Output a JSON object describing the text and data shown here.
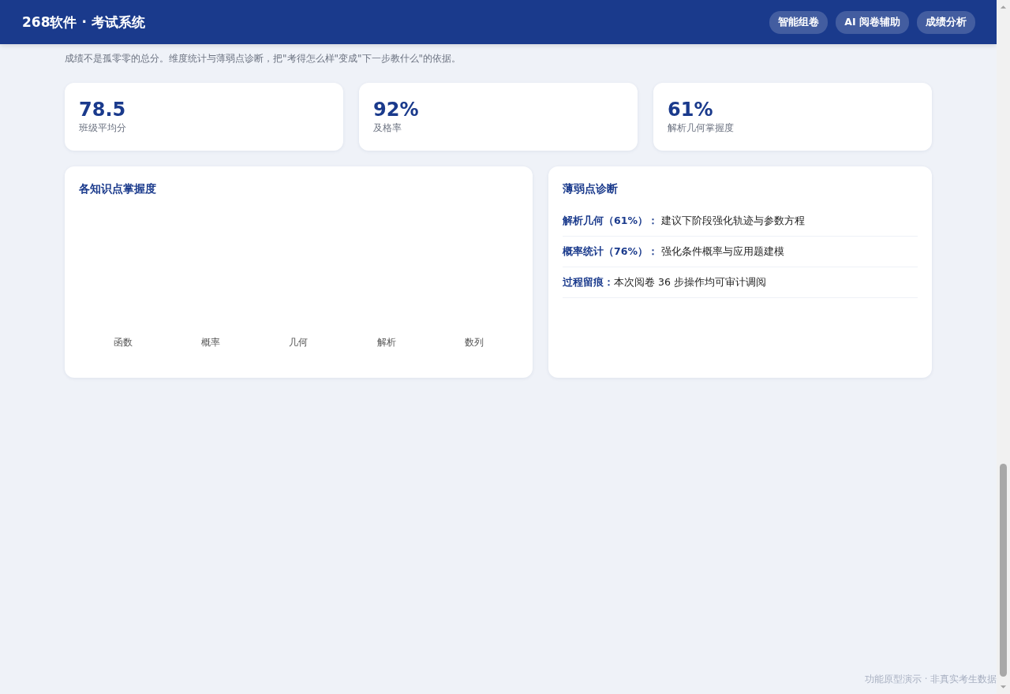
{
  "header": {
    "brand": "268软件 · 考试系统",
    "nav": [
      {
        "label": "智能组卷"
      },
      {
        "label": "AI 阅卷辅助"
      },
      {
        "label": "成绩分析"
      }
    ]
  },
  "subtitle": "成绩不是孤零零的总分。维度统计与薄弱点诊断，把\"考得怎么样\"变成\"下一步教什么\"的依据。",
  "stats": [
    {
      "value": "78.5",
      "label": "班级平均分"
    },
    {
      "value": "92%",
      "label": "及格率"
    },
    {
      "value": "61%",
      "label": "解析几何掌握度"
    }
  ],
  "mastery_panel": {
    "title": "各知识点掌握度",
    "categories": [
      "函数",
      "概率",
      "几何",
      "解析",
      "数列"
    ]
  },
  "diagnosis_panel": {
    "title": "薄弱点诊断",
    "items": [
      {
        "text": "**解析几何（61%）：** 建议下阶段强化轨迹与参数方程"
      },
      {
        "text": "**概率统计（76%）：** 强化条件概率与应用题建模"
      },
      {
        "text": "**过程留痕：**本次阅卷 36 步操作均可审计调阅"
      }
    ]
  },
  "footer": "功能原型演示 · 非真实考生数据"
}
